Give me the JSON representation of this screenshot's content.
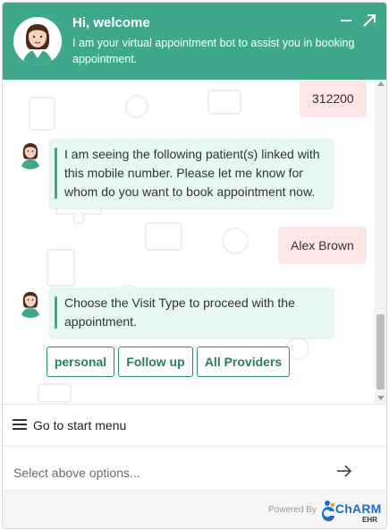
{
  "header": {
    "title": "Hi, welcome",
    "subtitle": "I am your virtual appointment bot to assist you in booking appointment.",
    "minimize_icon": "minimize-icon",
    "expand_icon": "expand-arrow-icon"
  },
  "chat": {
    "messages": [
      {
        "from": "user",
        "text": "312200"
      },
      {
        "from": "bot",
        "text": "I am seeing the following patient(s) linked with this mobile number. Please let me know for whom do you want to book appointment now."
      },
      {
        "from": "user",
        "text": "Alex Brown"
      },
      {
        "from": "bot",
        "text": "Choose the Visit Type to proceed with the appointment."
      }
    ],
    "options": [
      "personal",
      "Follow up",
      "All Providers"
    ]
  },
  "menu": {
    "label": "Go to start menu",
    "icon": "hamburger-menu-icon"
  },
  "input": {
    "placeholder": "Select above options...",
    "send_icon": "arrow-right-icon"
  },
  "footer": {
    "powered_by": "Powered By",
    "brand": "ChARM",
    "brand_sub": "EHR"
  },
  "colors": {
    "accent": "#3fa88c",
    "bot_bubble": "#e6f7f4",
    "user_bubble": "#fde6e6",
    "option_border": "#2b8a72",
    "brand_blue": "#1e6fc4"
  }
}
